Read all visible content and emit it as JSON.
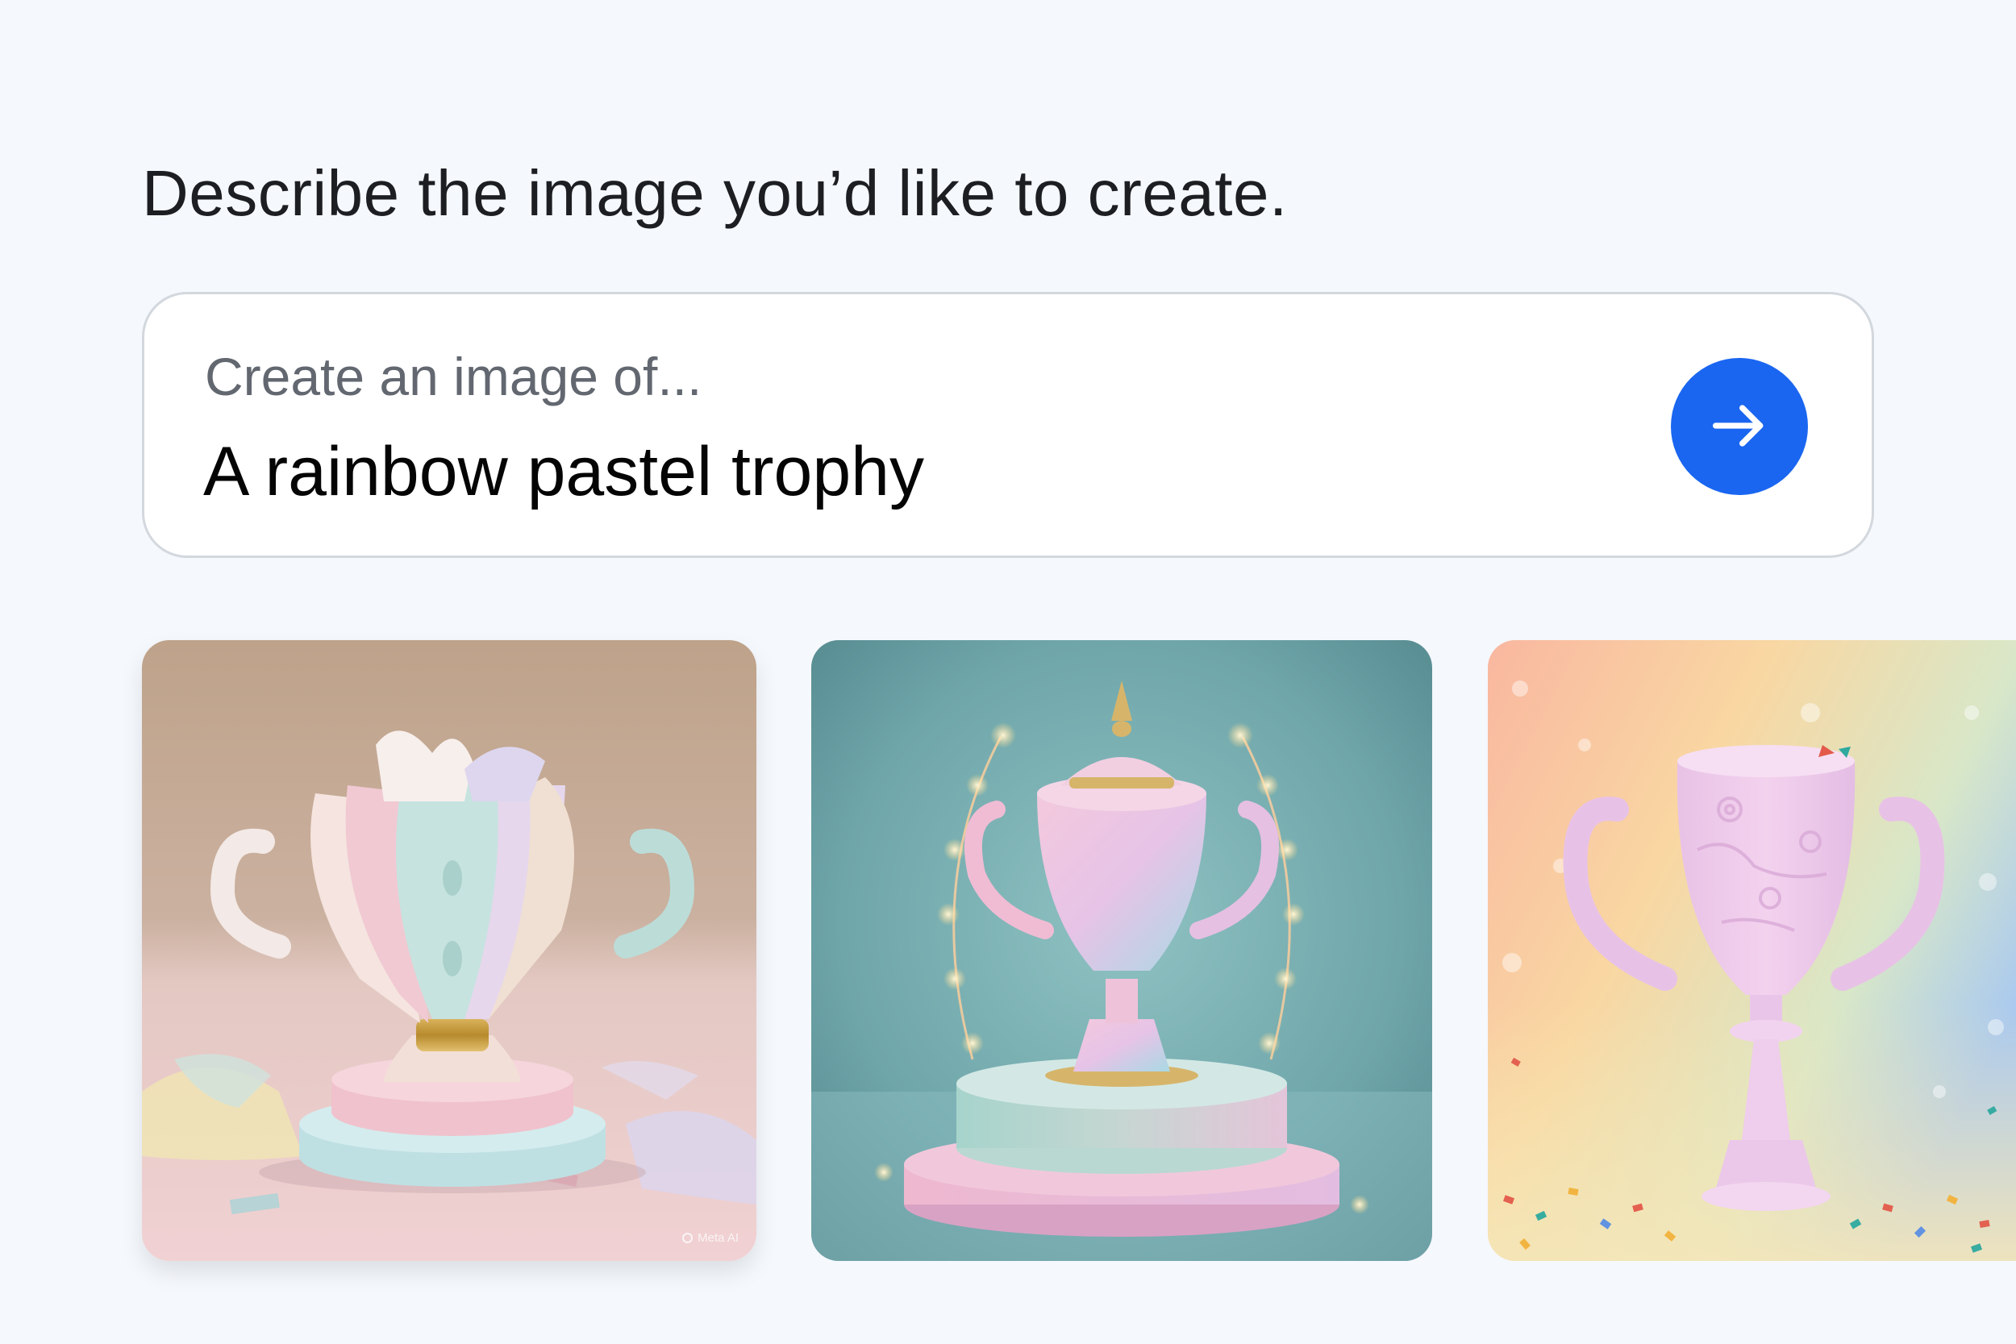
{
  "header": {
    "headline": "Describe the image you’d like to create."
  },
  "prompt": {
    "label": "Create an image of...",
    "value": "A rainbow pastel trophy",
    "submit_icon": "arrow-right-icon",
    "submit_color": "#1a66f0"
  },
  "results": [
    {
      "name": "generated-image-1",
      "subject": "pastel petal trophy",
      "watermark": "Meta AI"
    },
    {
      "name": "generated-image-2",
      "subject": "pastel trophy on pedestal with lights"
    },
    {
      "name": "generated-image-3",
      "subject": "pink trophy with confetti"
    }
  ],
  "colors": {
    "background": "#f5f8fd",
    "card_border": "#d3d8de",
    "accent": "#1a66f0"
  }
}
